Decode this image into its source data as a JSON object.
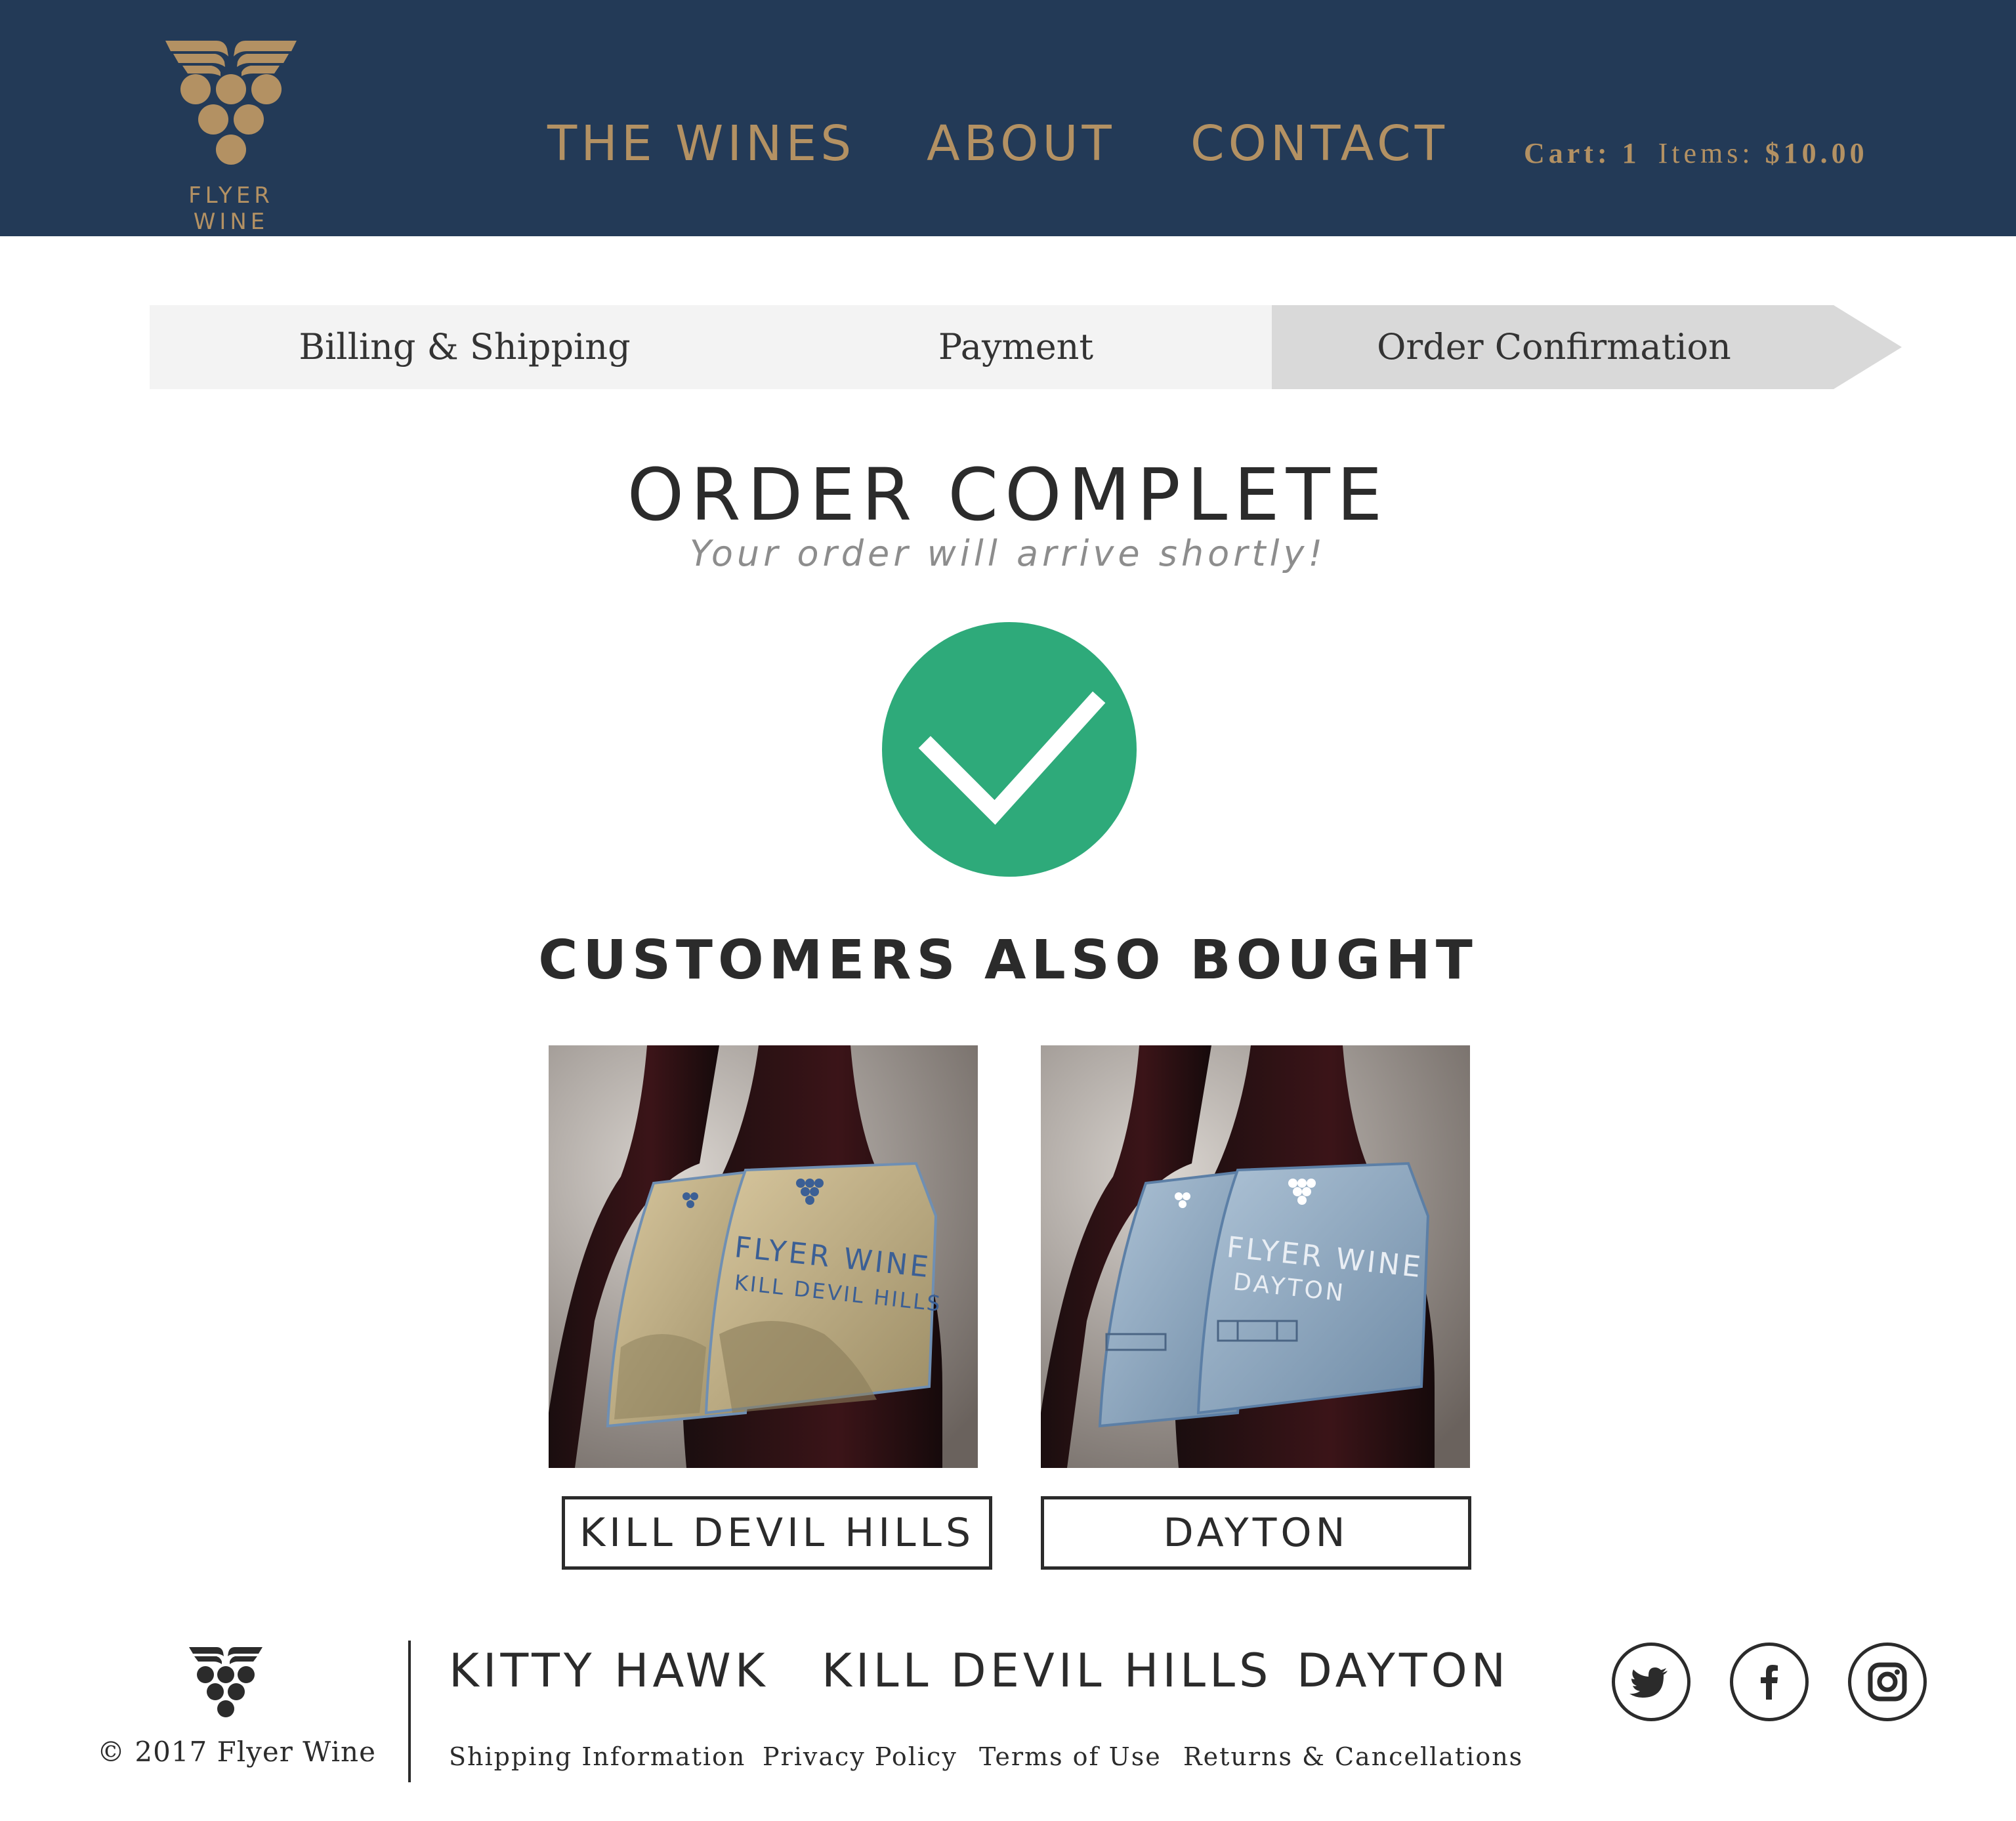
{
  "header": {
    "logo_text": "FLYER WINE",
    "nav": [
      "THE WINES",
      "ABOUT",
      "CONTACT"
    ],
    "cart": {
      "cart_label": "Cart:",
      "cart_count": "1",
      "items_label": "Items:",
      "total": "$10.00"
    }
  },
  "stepper": {
    "steps": [
      "Billing & Shipping",
      "Payment",
      "Order Confirmation"
    ],
    "active_step": "Order Confirmation"
  },
  "confirmation": {
    "title": "ORDER COMPLETE",
    "subtitle": "Your order will arrive shortly!",
    "icon": "checkmark-icon"
  },
  "also_bought": {
    "title": "CUSTOMERS ALSO  BOUGHT",
    "products": [
      {
        "label_line1": "FLYER WINE",
        "label_line2": "KILL DEVIL HILLS",
        "button": "KILL DEVIL HILLS"
      },
      {
        "label_line1": "FLYER WINE",
        "label_line2": "DAYTON",
        "button": "DAYTON"
      }
    ]
  },
  "footer": {
    "copyright": "© 2017 Flyer Wine",
    "nav": [
      "KITTY HAWK",
      "KILL DEVIL HILLS",
      "DAYTON"
    ],
    "links": [
      "Shipping Information",
      "Privacy Policy",
      "Terms of Use",
      "Returns & Cancellations"
    ],
    "social": [
      "twitter-icon",
      "facebook-icon",
      "instagram-icon"
    ]
  },
  "colors": {
    "header_bg": "#233a57",
    "gold": "#b39163",
    "success": "#2eaa7a",
    "text": "#2b2b2b"
  }
}
